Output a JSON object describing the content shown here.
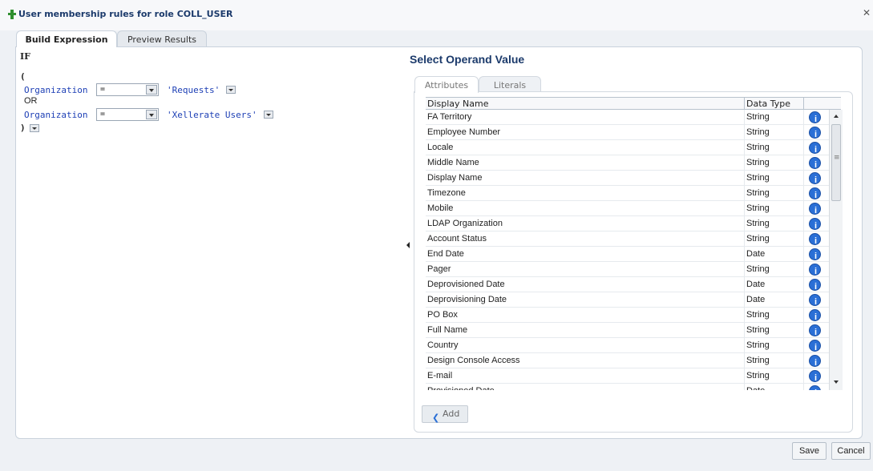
{
  "window": {
    "title": "User membership rules for role COLL_USER",
    "close_label": "✕"
  },
  "tabs": [
    {
      "label": "Build Expression",
      "active": true
    },
    {
      "label": "Preview Results",
      "active": false
    }
  ],
  "expression": {
    "if_label": "IF",
    "open_paren": "(",
    "close_paren": ")",
    "rows": [
      {
        "attribute": "Organization",
        "operator": "=",
        "value": "'Requests'"
      },
      {
        "attribute": "Organization",
        "operator": "=",
        "value": "'Xellerate Users'"
      }
    ],
    "connector": "OR"
  },
  "operand": {
    "title": "Select Operand Value",
    "subtabs": [
      {
        "label": "Attributes",
        "active": true
      },
      {
        "label": "Literals",
        "active": false
      }
    ],
    "columns": [
      "Display Name",
      "Data Type",
      ""
    ],
    "rows": [
      {
        "name": "FA Territory",
        "type": "String"
      },
      {
        "name": "Employee Number",
        "type": "String"
      },
      {
        "name": "Locale",
        "type": "String"
      },
      {
        "name": "Middle Name",
        "type": "String"
      },
      {
        "name": "Display Name",
        "type": "String"
      },
      {
        "name": "Timezone",
        "type": "String"
      },
      {
        "name": "Mobile",
        "type": "String"
      },
      {
        "name": "LDAP Organization",
        "type": "String"
      },
      {
        "name": "Account Status",
        "type": "String"
      },
      {
        "name": "End Date",
        "type": "Date"
      },
      {
        "name": "Pager",
        "type": "String"
      },
      {
        "name": "Deprovisioned Date",
        "type": "Date"
      },
      {
        "name": "Deprovisioning Date",
        "type": "Date"
      },
      {
        "name": "PO Box",
        "type": "String"
      },
      {
        "name": "Full Name",
        "type": "String"
      },
      {
        "name": "Country",
        "type": "String"
      },
      {
        "name": "Design Console Access",
        "type": "String"
      },
      {
        "name": "E-mail",
        "type": "String"
      },
      {
        "name": "Provisioned Date",
        "type": "Date"
      }
    ],
    "info_glyph": "i",
    "add_label": "Add"
  },
  "footer": {
    "save_label": "Save",
    "cancel_label": "Cancel"
  },
  "colors": {
    "title": "#1b3a6b",
    "link": "#1d3fb5",
    "info": "#2a6fd6"
  }
}
